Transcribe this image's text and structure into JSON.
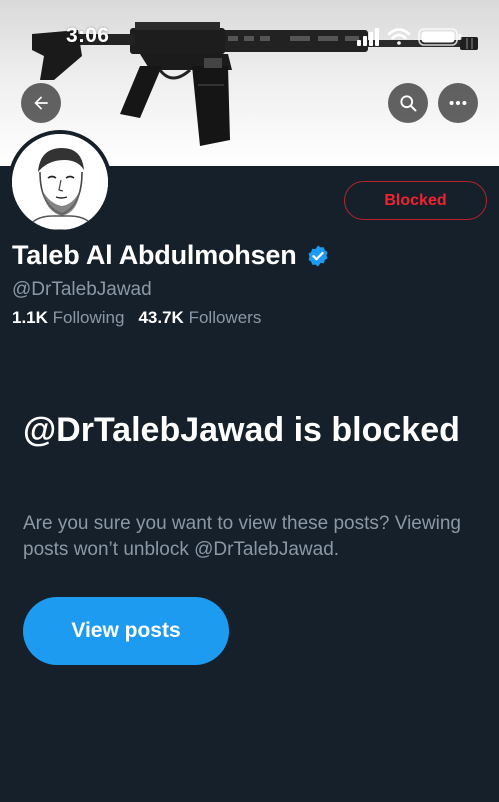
{
  "status_bar": {
    "time": "3:06"
  },
  "header": {
    "back_icon": "arrow-left-icon",
    "search_icon": "search-icon",
    "more_icon": "more-horizontal-icon"
  },
  "profile": {
    "display_name": "Taleb Al Abdulmohsen",
    "verified_icon": "verified-badge-icon",
    "handle": "@DrTalebJawad",
    "following_count": "1.1K",
    "following_label": "Following",
    "followers_count": "43.7K",
    "followers_label": "Followers",
    "blocked_label": "Blocked"
  },
  "blocked_notice": {
    "title": "@DrTalebJawad is blocked",
    "description": "Are you sure you want to view these posts? Viewing posts won’t unblock @DrTalebJawad.",
    "view_posts_label": "View posts"
  },
  "colors": {
    "background": "#15202b",
    "accent": "#1d9bf0",
    "blocked_red": "#f4212e",
    "secondary_text": "#8b98a5"
  }
}
